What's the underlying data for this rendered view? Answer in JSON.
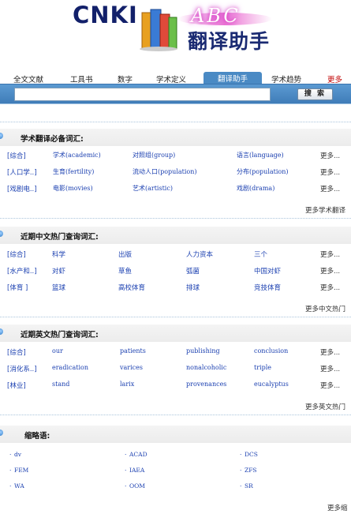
{
  "logo": {
    "brand": "CNKI",
    "script_text": "ABC",
    "title": "翻译助手"
  },
  "tabs": [
    {
      "label": "全文文献"
    },
    {
      "label": "工具书"
    },
    {
      "label": "数字"
    },
    {
      "label": "学术定义"
    },
    {
      "label": "翻译助手"
    },
    {
      "label": "学术趋势"
    },
    {
      "label": "更多"
    }
  ],
  "search": {
    "value": "",
    "button_label": "搜 索"
  },
  "sections": {
    "academic": {
      "title": "学术翻译必备词汇:",
      "rows": [
        {
          "cat": "[综合]",
          "t1": "学术(academic)",
          "t2": "对照组(group)",
          "t3": "语言(language)",
          "more": "更多..."
        },
        {
          "cat": "[人口学..]",
          "t1": "生育(fertility)",
          "t2": "流动人口(population)",
          "t3": "分布(population)",
          "more": "更多..."
        },
        {
          "cat": "[戏剧电..]",
          "t1": "电影(movies)",
          "t2": "艺术(artistic)",
          "t3": "戏剧(drama)",
          "more": "更多..."
        }
      ],
      "more_link": "更多学术翻译"
    },
    "chinese_hot": {
      "title": "近期中文热门查询词汇:",
      "rows": [
        {
          "cat": "[综合]",
          "t1": "科学",
          "t2": "出版",
          "t3": "人力资本",
          "t4": "三个",
          "more": "更多..."
        },
        {
          "cat": "[水产和..]",
          "t1": "对虾",
          "t2": "草鱼",
          "t3": "弧菌",
          "t4": "中国对虾",
          "more": "更多..."
        },
        {
          "cat": "[体育 ]",
          "t1": "篮球",
          "t2": "高校体育",
          "t3": "排球",
          "t4": "竞技体育",
          "more": "更多..."
        }
      ],
      "more_link": "更多中文热门"
    },
    "english_hot": {
      "title": "近期英文热门查询词汇:",
      "rows": [
        {
          "cat": "[综合]",
          "t1": "our",
          "t2": "patients",
          "t3": "publishing",
          "t4": "conclusion",
          "more": "更多..."
        },
        {
          "cat": "[消化系..]",
          "t1": "eradication",
          "t2": "varices",
          "t3": "nonalcoholic",
          "t4": "triple",
          "more": "更多..."
        },
        {
          "cat": "[林业]",
          "t1": "stand",
          "t2": "larix",
          "t3": "provenances",
          "t4": "eucalyptus",
          "more": "更多..."
        }
      ],
      "more_link": "更多英文热门"
    },
    "abbreviations": {
      "title": "缩略语:",
      "rows": [
        {
          "a": "dv",
          "b": "ACAD",
          "c": "DCS"
        },
        {
          "a": "FEM",
          "b": "IAEA",
          "c": "ZFS"
        },
        {
          "a": "WA",
          "b": "OOM",
          "c": "SR"
        }
      ],
      "more_link": "更多缩"
    }
  }
}
